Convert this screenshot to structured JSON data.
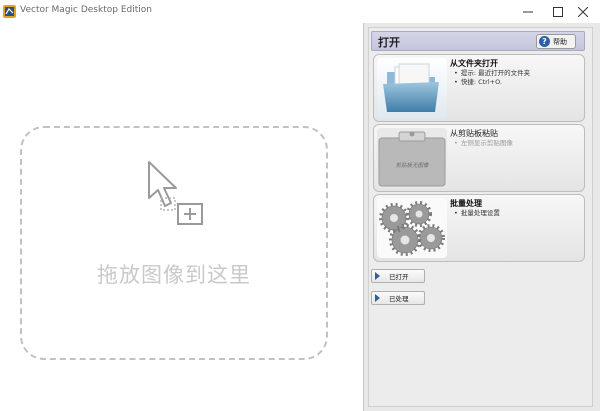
{
  "window": {
    "title": "Vector Magic Desktop Edition",
    "minimize_icon": "minimize-icon",
    "maximize_icon": "maximize-icon",
    "close_icon": "close-icon"
  },
  "drop_zone": {
    "text": "拖放图像到这里",
    "icon": "cursor-drop-icon"
  },
  "panel": {
    "section_title": "打开",
    "help_label": "帮助",
    "help_icon_glyph": "?",
    "cards": [
      {
        "title": "从文件夹打开",
        "bullets": [
          "提示: 最近打开的文件夹",
          "快捷: Ctrl+O."
        ],
        "icon": "folder-icon",
        "enabled": true
      },
      {
        "title": "从剪贴板粘贴",
        "bullets": [
          "左侧显示剪贴图像"
        ],
        "thumb_label": "剪贴板无图像",
        "icon": "clipboard-icon",
        "enabled": false
      },
      {
        "title": "批量处理",
        "bullets": [
          "批量处理设置"
        ],
        "icon": "gears-icon",
        "enabled": true
      }
    ],
    "buttons": {
      "opened_label": "已打开",
      "processed_label": "已处理"
    }
  },
  "colors": {
    "accent_blue": "#2f5fa3",
    "header_bg": "#c4c4dc",
    "drop_zone_border": "#c2c2c2"
  }
}
